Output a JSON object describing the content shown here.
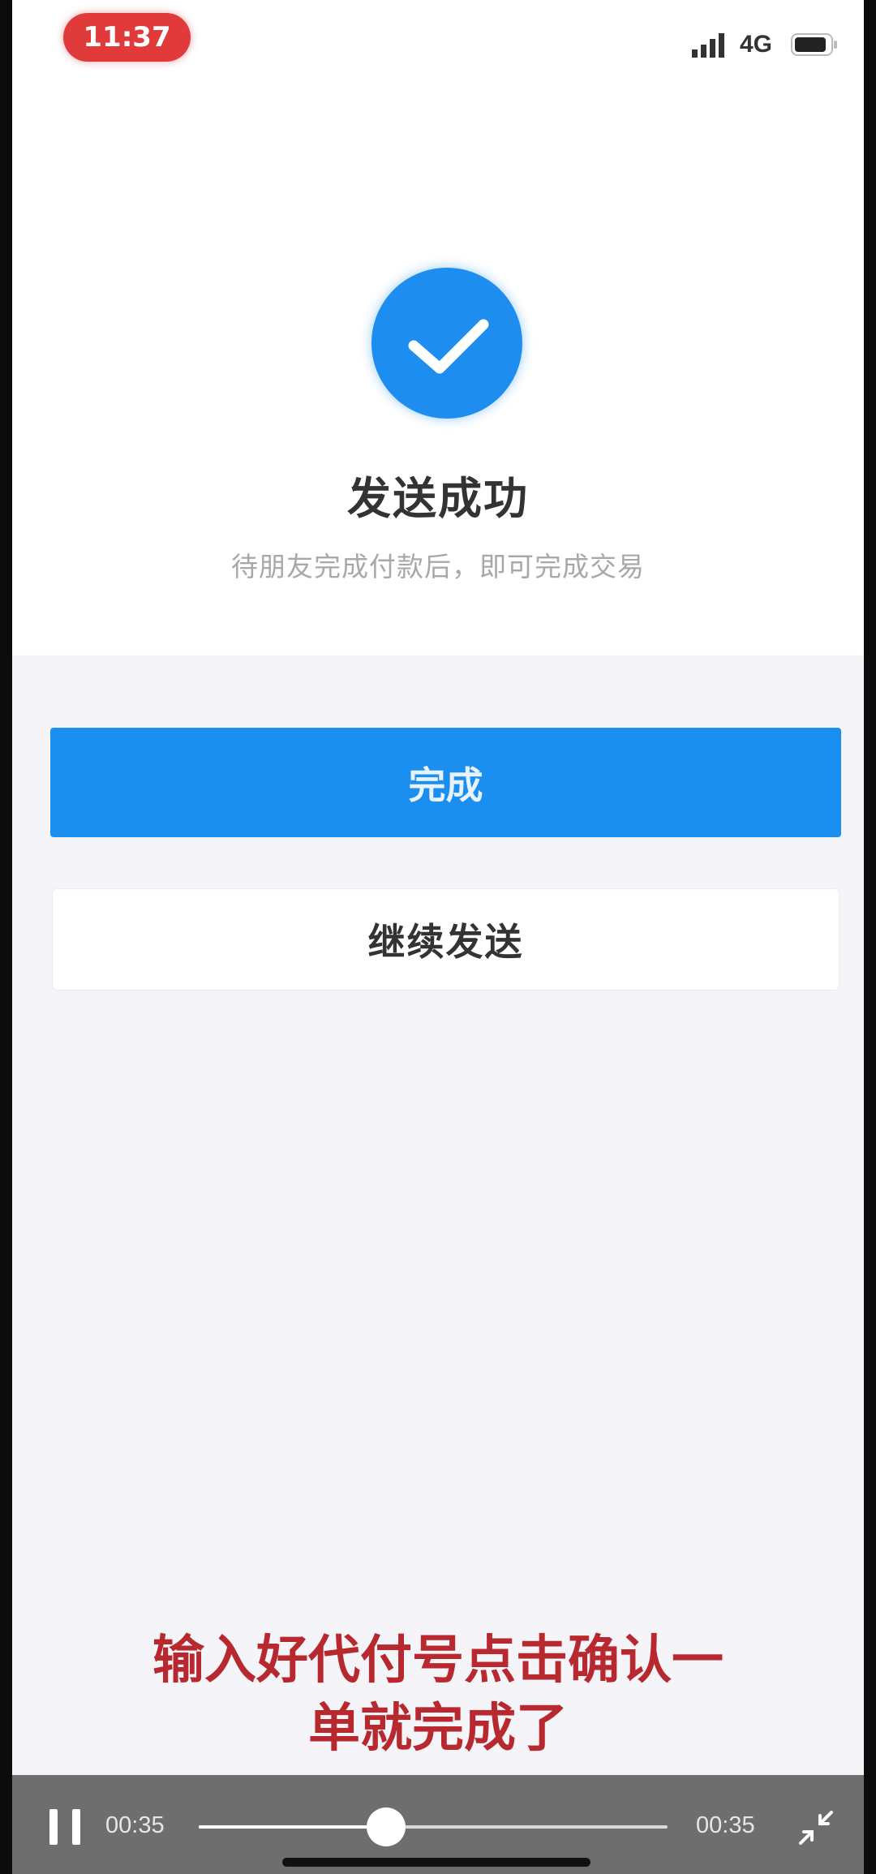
{
  "status_bar": {
    "time": "11:37",
    "network": "4G",
    "icons": [
      "signal-icon",
      "battery-icon"
    ],
    "time_pill_color": "#e03a3a"
  },
  "result": {
    "icon": "checkmark-icon",
    "title": "发送成功",
    "subtitle": "待朋友完成付款后，即可完成交易"
  },
  "buttons": {
    "primary_label": "完成",
    "secondary_label": "继续发送"
  },
  "caption": {
    "line1": "输入好代付号点击确认一",
    "line2": "单就完成了"
  },
  "player": {
    "current_time": "00:35",
    "total_time": "00:35",
    "progress": 0.4,
    "icons": [
      "pause-icon",
      "collapse-icon"
    ]
  },
  "colors": {
    "accent": "#1b8ff0",
    "caption": "#b8292f",
    "page_bg": "#f5f5f9"
  }
}
